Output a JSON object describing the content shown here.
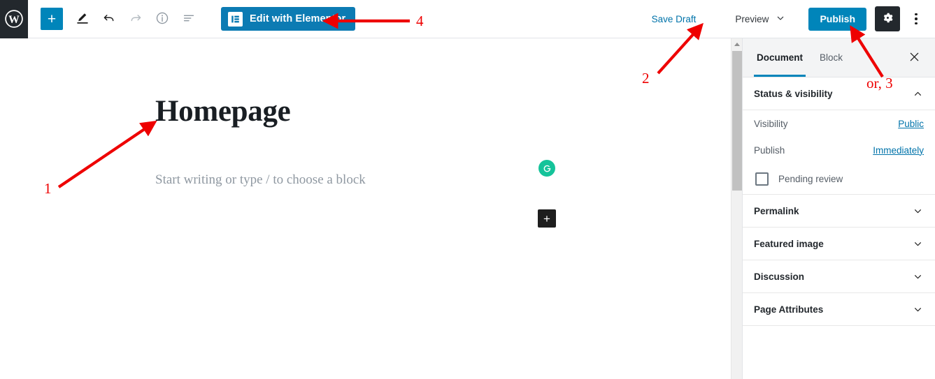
{
  "toolbar": {
    "wp_logo_label": "WordPress",
    "add_block_label": "+",
    "edit_tools_icon": "pencil-icon",
    "undo_icon": "undo-icon",
    "redo_icon": "redo-icon",
    "info_icon": "info-icon",
    "outline_icon": "list-view-icon",
    "elementor_button_label": "Edit with Elementor",
    "save_draft_label": "Save Draft",
    "preview_label": "Preview",
    "publish_label": "Publish",
    "settings_icon": "gear-icon",
    "more_icon": "vertical-dots-icon"
  },
  "editor": {
    "post_title": "Homepage",
    "paragraph_placeholder": "Start writing or type / to choose a block",
    "grammarly_icon": "grammarly-icon",
    "grammarly_letter": "G",
    "inline_inserter_label": "+"
  },
  "sidebar": {
    "tabs": [
      {
        "label": "Document",
        "active": true
      },
      {
        "label": "Block",
        "active": false
      }
    ],
    "close_icon": "close-icon",
    "status_panel": {
      "title": "Status & visibility",
      "expanded": true,
      "rows": [
        {
          "label": "Visibility",
          "value": "Public"
        },
        {
          "label": "Publish",
          "value": "Immediately"
        }
      ],
      "pending_review_label": "Pending review",
      "pending_review_checked": false
    },
    "panels": [
      {
        "title": "Permalink"
      },
      {
        "title": "Featured image"
      },
      {
        "title": "Discussion"
      },
      {
        "title": "Page Attributes"
      }
    ]
  },
  "annotations": {
    "color": "#ee0000",
    "items": [
      {
        "label": "1",
        "target": "post-title"
      },
      {
        "label": "2",
        "target": "save-draft"
      },
      {
        "label": "or, 3",
        "target": "publish-button"
      },
      {
        "label": "4",
        "target": "edit-with-elementor"
      }
    ]
  },
  "colors": {
    "accent_blue": "#0085ba",
    "elementor_blue": "#0c7bb3",
    "link_blue": "#0073aa",
    "dark": "#23282d",
    "grammarly_green": "#15c39a",
    "annotation_red": "#ee0000"
  }
}
